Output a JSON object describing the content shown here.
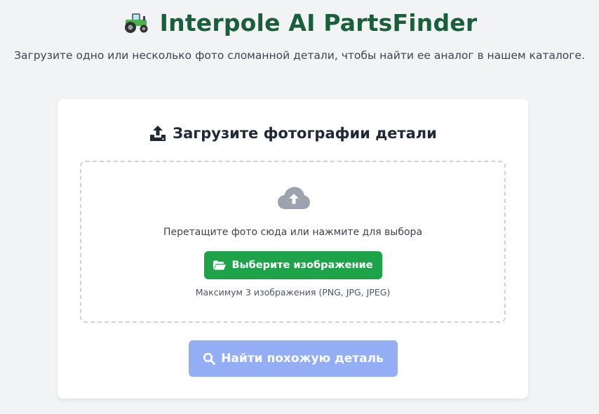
{
  "header": {
    "icon": "tractor-icon",
    "title": "Interpole AI PartsFinder",
    "subtitle": "Загрузите одно или несколько фото сломанной детали, чтобы найти ее аналог в нашем каталоге.",
    "title_color": "#1b5e3b"
  },
  "upload_card": {
    "heading_icon": "upload-icon",
    "heading": "Загрузите фотографии детали",
    "dropzone": {
      "icon": "cloud-upload-icon",
      "instruction": "Перетащите фото сюда или нажмите для выбора",
      "choose_button": {
        "icon": "folder-open-icon",
        "label": "Выберите изображение",
        "color": "#1fa34a"
      },
      "limit_note": "Максимум 3 изображения (PNG, JPG, JPEG)"
    },
    "find_button": {
      "icon": "search-icon",
      "label": "Найти похожую деталь",
      "color": "#93aef5"
    }
  }
}
